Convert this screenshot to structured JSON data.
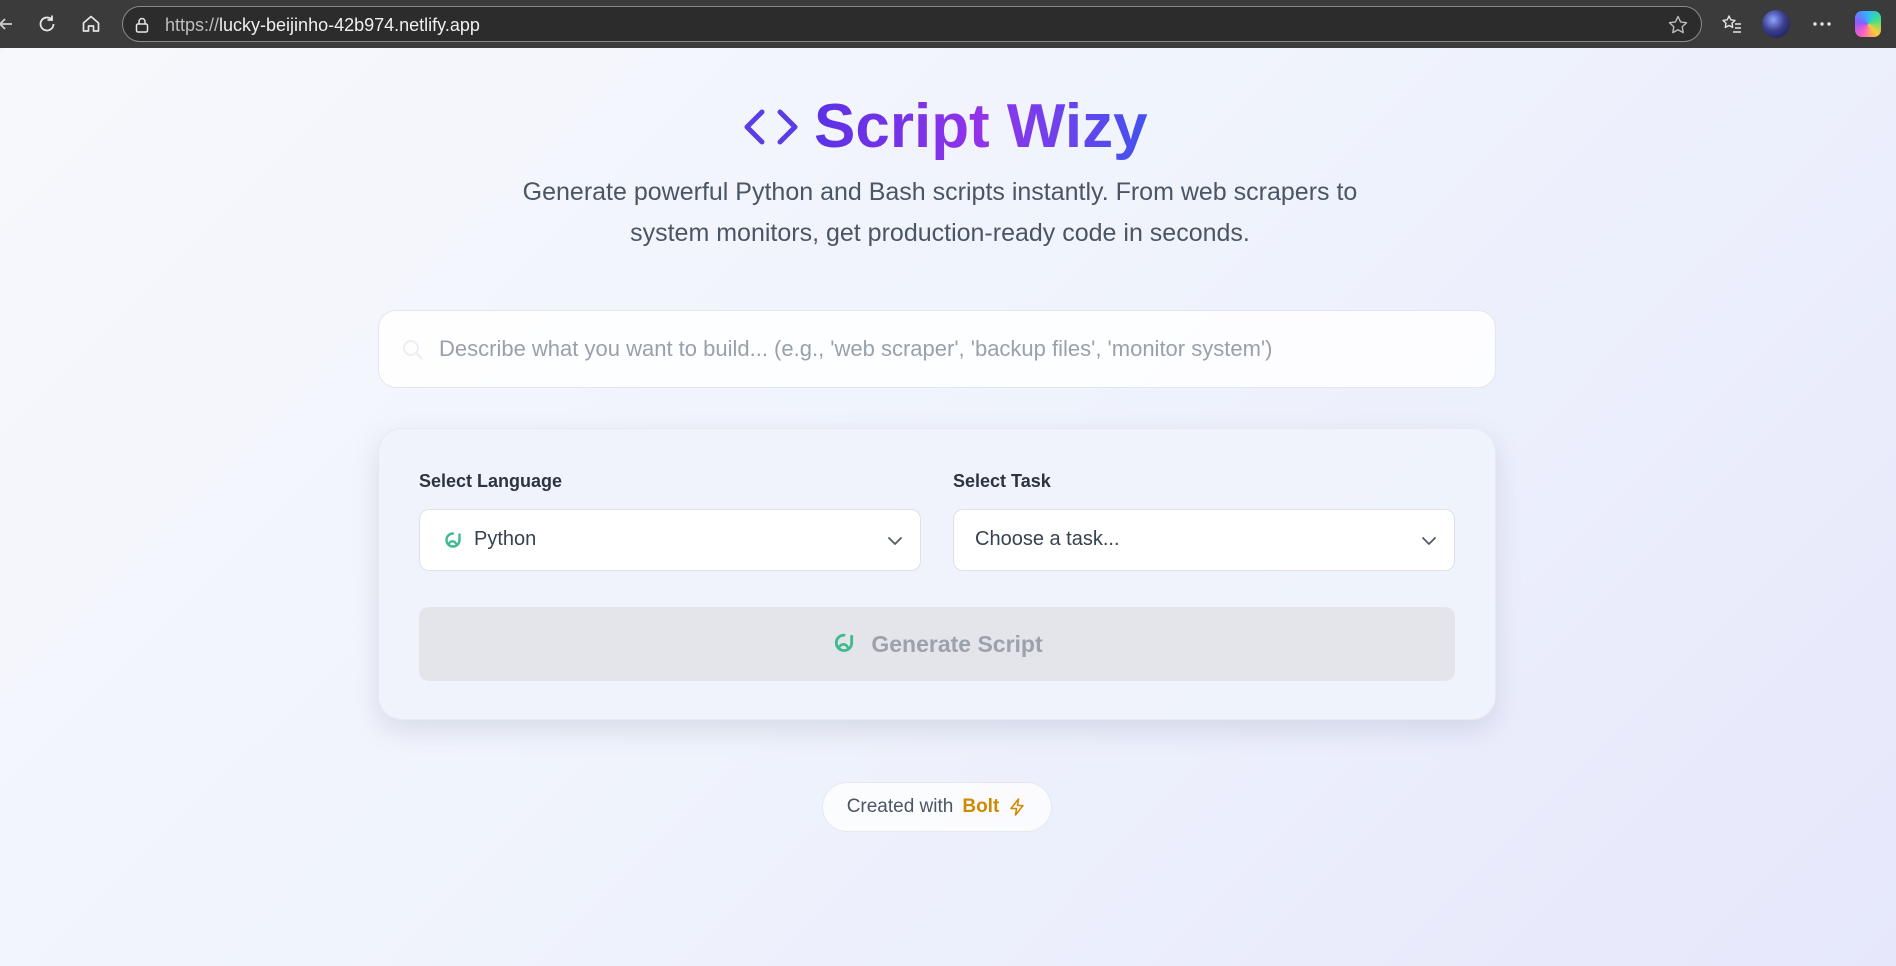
{
  "browser": {
    "url_host_prefix": "https://",
    "url_host": "lucky-beijinho-42b974.netlify.app"
  },
  "header": {
    "title": "Script Wizy",
    "subtitle": "Generate powerful Python and Bash scripts instantly. From web scrapers to system monitors, get production-ready code in seconds."
  },
  "search": {
    "placeholder": "Describe what you want to build... (e.g., 'web scraper', 'backup files', 'monitor system')",
    "value": ""
  },
  "form": {
    "language_label": "Select Language",
    "language_value": "Python",
    "task_label": "Select Task",
    "task_value": "Choose a task...",
    "generate_label": "Generate Script"
  },
  "footer": {
    "created_text": "Created with",
    "bolt_text": "Bolt"
  },
  "colors": {
    "title_gradient_start": "#5a32e6",
    "title_gradient_mid": "#9333ea",
    "python_icon": "#3fb98e",
    "bolt_accent": "#d08a00"
  },
  "icons": [
    "back-icon",
    "reload-icon",
    "home-icon",
    "lock-icon",
    "favorite-star-icon",
    "favorites-icon",
    "profile-avatar",
    "more-icon",
    "copilot-icon",
    "code-icon",
    "search-icon",
    "python-icon",
    "chevron-down-icon",
    "bolt-icon"
  ]
}
